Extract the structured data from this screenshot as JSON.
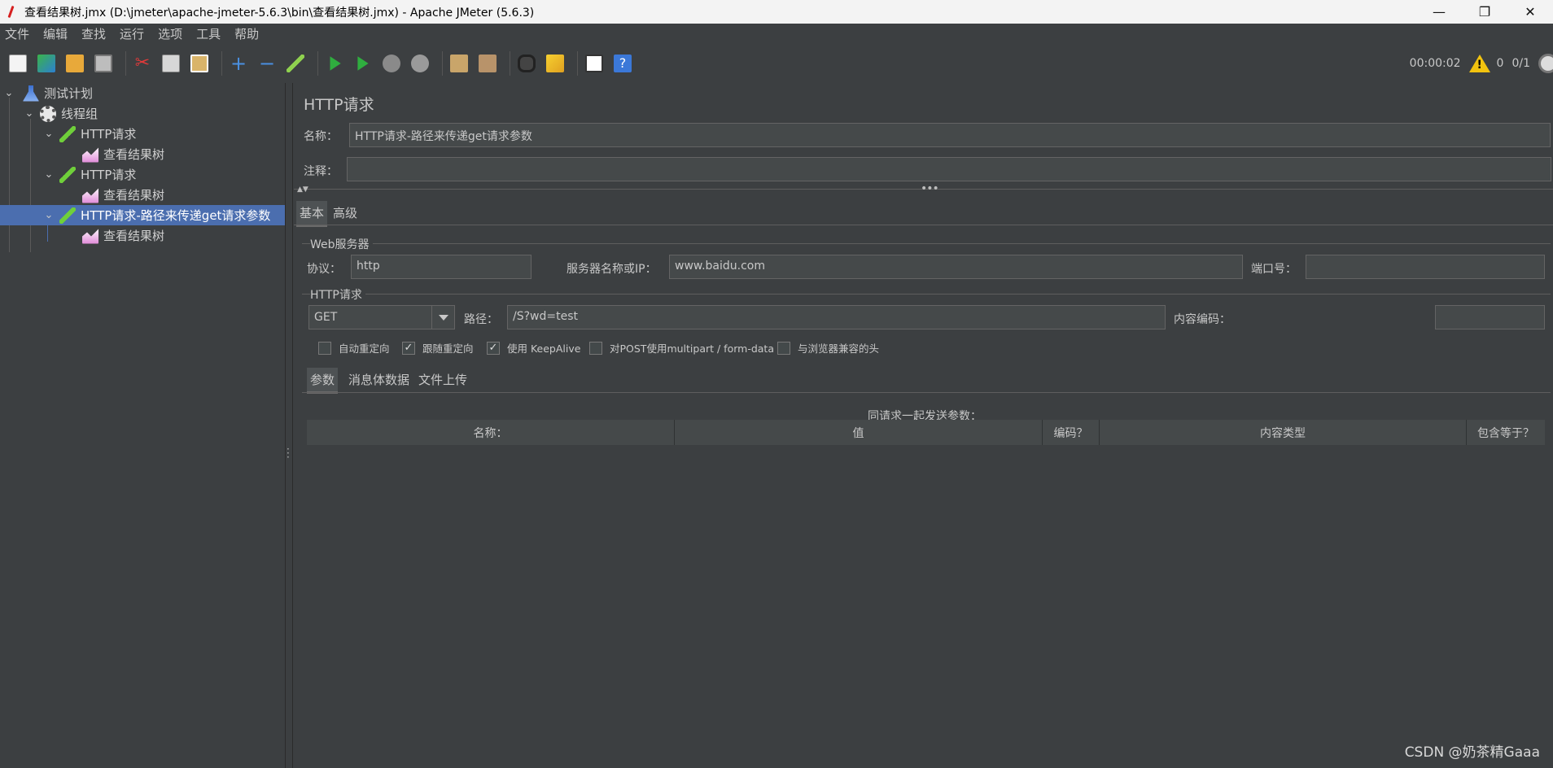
{
  "window": {
    "title": "查看结果树.jmx (D:\\jmeter\\apache-jmeter-5.6.3\\bin\\查看结果树.jmx) - Apache JMeter (5.6.3)",
    "minimize": "—",
    "maximize": "❐",
    "close": "✕"
  },
  "menu": [
    "文件",
    "编辑",
    "查找",
    "运行",
    "选项",
    "工具",
    "帮助"
  ],
  "toolbar": {
    "timer": "00:00:02",
    "warning_count": "0",
    "threads": "0/1",
    "icons": [
      "new-icon",
      "templates-icon",
      "open-icon",
      "save-icon",
      "cut-icon",
      "copy-icon",
      "paste-icon",
      "expand-icon",
      "collapse-icon",
      "toggle-icon",
      "start-icon",
      "start-no-pause-icon",
      "stop-icon",
      "shutdown-icon",
      "clear-icon",
      "clear-all-icon",
      "search-icon",
      "reset-search-icon",
      "function-helper-icon",
      "help-icon"
    ]
  },
  "tree": {
    "items": [
      {
        "label": "测试计划",
        "icon": "flask-icon"
      },
      {
        "label": "线程组",
        "icon": "gear-icon"
      },
      {
        "label": "HTTP请求",
        "icon": "pipette-icon"
      },
      {
        "label": "查看结果树",
        "icon": "chart-icon"
      },
      {
        "label": "HTTP请求",
        "icon": "pipette-icon"
      },
      {
        "label": "查看结果树",
        "icon": "chart-icon"
      },
      {
        "label": "HTTP请求-路径来传递get请求参数",
        "icon": "pipette-icon"
      },
      {
        "label": "查看结果树",
        "icon": "chart-icon"
      }
    ]
  },
  "main": {
    "title": "HTTP请求",
    "name_label": "名称：",
    "name_value": "HTTP请求-路径来传递get请求参数",
    "comment_label": "注释：",
    "comment_value": "",
    "tabs": [
      "基本",
      "高级"
    ],
    "web_server": {
      "group": "Web服务器",
      "protocol_label": "协议：",
      "protocol_value": "http",
      "server_label": "服务器名称或IP：",
      "server_value": "www.baidu.com",
      "port_label": "端口号：",
      "port_value": ""
    },
    "http_request": {
      "group": "HTTP请求",
      "method": "GET",
      "path_label": "路径：",
      "path_value": "/S?wd=test",
      "encoding_label": "内容编码：",
      "encoding_value": ""
    },
    "checkboxes": [
      {
        "label": "自动重定向",
        "checked": false,
        "mark": ""
      },
      {
        "label": "跟随重定向",
        "checked": true,
        "mark": "✓"
      },
      {
        "label": "使用 KeepAlive",
        "checked": true,
        "mark": "✓"
      },
      {
        "label": "对POST使用multipart / form-data",
        "checked": false,
        "mark": ""
      },
      {
        "label": "与浏览器兼容的头",
        "checked": false,
        "mark": ""
      }
    ],
    "sub_tabs": [
      "参数",
      "消息体数据",
      "文件上传"
    ],
    "params_caption": "同请求一起发送参数：",
    "columns": [
      "名称：",
      "值",
      "编码？",
      "内容类型",
      "包含等于？"
    ]
  },
  "watermark": "CSDN @奶茶精Gaaa"
}
